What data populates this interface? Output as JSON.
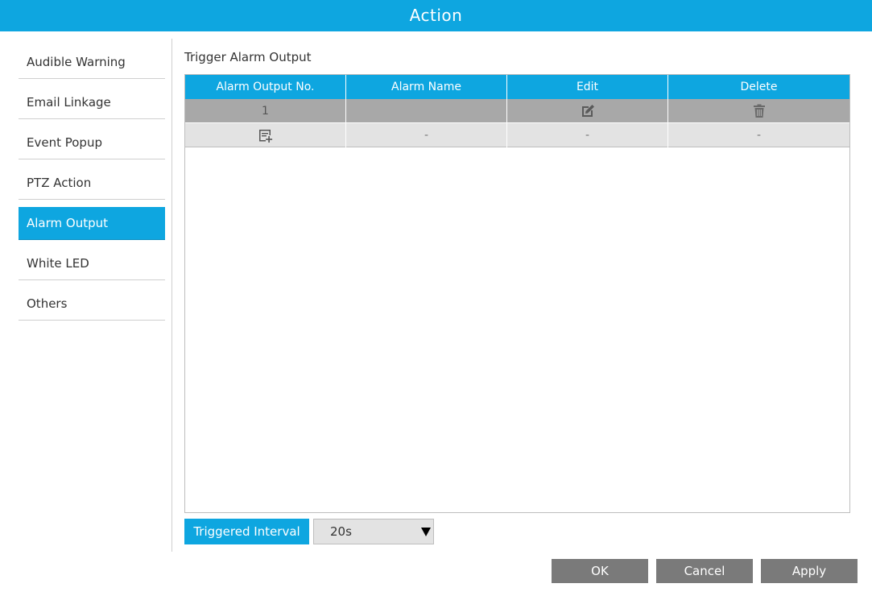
{
  "window": {
    "title": "Action"
  },
  "sidebar": {
    "items": [
      {
        "label": "Audible Warning"
      },
      {
        "label": "Email Linkage"
      },
      {
        "label": "Event Popup"
      },
      {
        "label": "PTZ Action"
      },
      {
        "label": "Alarm Output",
        "active": true
      },
      {
        "label": "White LED"
      },
      {
        "label": "Others"
      }
    ]
  },
  "main": {
    "section_title": "Trigger Alarm Output",
    "table": {
      "headers": [
        "Alarm Output No.",
        "Alarm Name",
        "Edit",
        "Delete"
      ],
      "rows": [
        {
          "no": "1",
          "name": "",
          "edit_icon": "edit-icon",
          "delete_icon": "trash-icon"
        }
      ],
      "add_row": {
        "add_icon": "add-row-icon",
        "name": "-",
        "edit": "-",
        "delete": "-"
      }
    },
    "interval": {
      "label": "Triggered Interval",
      "value": "20s"
    }
  },
  "footer": {
    "ok_label": "OK",
    "cancel_label": "Cancel",
    "apply_label": "Apply"
  },
  "colors": {
    "accent": "#0ea6e0",
    "button": "#7a7a7a",
    "selected_row": "#a8a8a8",
    "add_row": "#e3e3e3"
  }
}
